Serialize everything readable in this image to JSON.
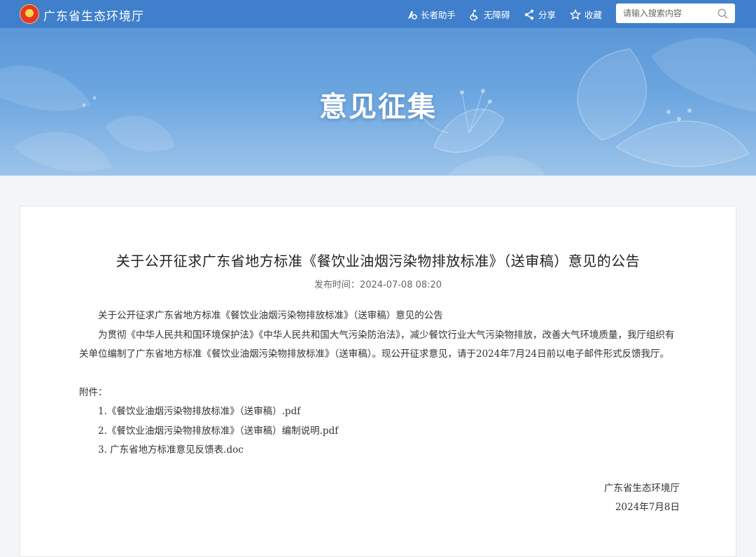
{
  "header": {
    "site_name": "广东省生态环境厅",
    "tools": [
      {
        "label": "长者助手",
        "icon": "elder-assist-icon"
      },
      {
        "label": "无障碍",
        "icon": "accessibility-icon"
      },
      {
        "label": "分享",
        "icon": "share-icon"
      },
      {
        "label": "收藏",
        "icon": "star-icon"
      }
    ],
    "search": {
      "placeholder": "请输入搜索内容",
      "value": ""
    }
  },
  "banner": {
    "title": "意见征集"
  },
  "article": {
    "title": "关于公开征求广东省地方标准《餐饮业油烟污染物排放标准》（送审稿）意见的公告",
    "publish_time": "发布时间：2024-07-08 08:20",
    "intro": "关于公开征求广东省地方标准《餐饮业油烟污染物排放标准》（送审稿）意见的公告",
    "paragraph": "为贯彻《中华人民共和国环境保护法》《中华人民共和国大气污染防治法》，减少餐饮行业大气污染物排放，改善大气环境质量，我厅组织有关单位编制了广东省地方标准《餐饮业油烟污染物排放标准》（送审稿）。现公开征求意见，请于2024年7月24日前以电子邮件形式反馈我厅。",
    "attachments_label": "附件：",
    "attachments": [
      "1.《餐饮业油烟污染物排放标准》（送审稿）.pdf",
      "2.《餐饮业油烟污染物排放标准》（送审稿）编制说明.pdf",
      "3. 广东省地方标准意见反馈表.doc"
    ],
    "signature": "广东省生态环境厅",
    "date": "2024年7月8日"
  },
  "colors": {
    "topbar": "#3f7fcc",
    "banner": "#6ca6e0",
    "card": "#ffffff",
    "page_bg": "#f3f5f8"
  }
}
